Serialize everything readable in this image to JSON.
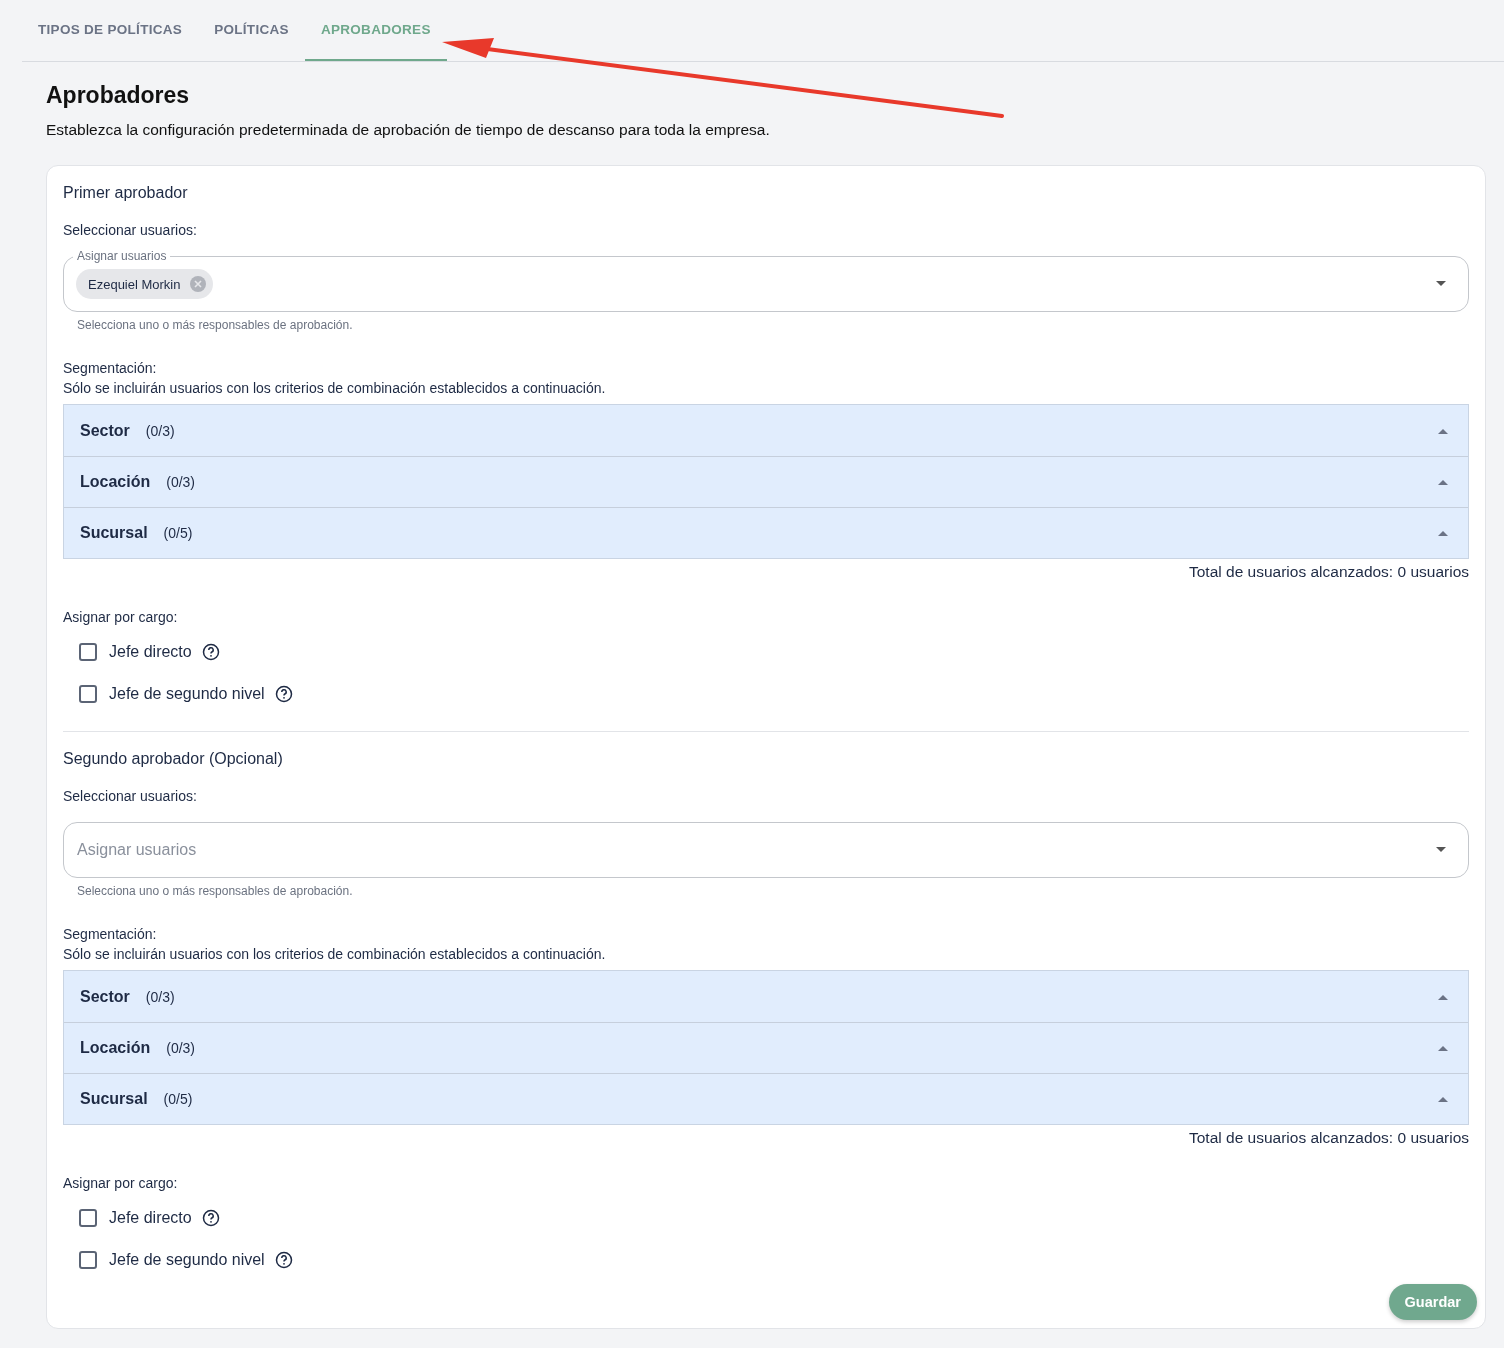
{
  "tabs": [
    {
      "label": "TIPOS DE POLÍTICAS",
      "selected": false
    },
    {
      "label": "POLÍTICAS",
      "selected": false
    },
    {
      "label": "APROBADORES",
      "selected": true
    }
  ],
  "page": {
    "title": "Aprobadores",
    "description": "Establezca la configuración predeterminada de aprobación de tiempo de descanso para toda la empresa."
  },
  "approvers": [
    {
      "title": "Primer aprobador",
      "select_label": "Seleccionar usuarios:",
      "field": {
        "label": "Asignar usuarios",
        "chips": [
          "Ezequiel Morkin"
        ]
      },
      "helper": "Selecciona uno o más responsables de aprobación.",
      "segmentation_label": "Segmentación:",
      "segmentation_note": "Sólo se incluirán usuarios con los criterios de combinación establecidos a continuación.",
      "groups": [
        {
          "name": "Sector",
          "count": "(0/3)"
        },
        {
          "name": "Locación",
          "count": "(0/3)"
        },
        {
          "name": "Sucursal",
          "count": "(0/5)"
        }
      ],
      "total": "Total de usuarios alcanzados: 0 usuarios",
      "role_label": "Asignar por cargo:",
      "roles": [
        {
          "label": "Jefe directo",
          "checked": false
        },
        {
          "label": "Jefe de segundo nivel",
          "checked": false
        }
      ]
    },
    {
      "title": "Segundo aprobador (Opcional)",
      "select_label": "Seleccionar usuarios:",
      "field": {
        "placeholder": "Asignar usuarios"
      },
      "helper": "Selecciona uno o más responsables de aprobación.",
      "segmentation_label": "Segmentación:",
      "segmentation_note": "Sólo se incluirán usuarios con los criterios de combinación establecidos a continuación.",
      "groups": [
        {
          "name": "Sector",
          "count": "(0/3)"
        },
        {
          "name": "Locación",
          "count": "(0/3)"
        },
        {
          "name": "Sucursal",
          "count": "(0/5)"
        }
      ],
      "total": "Total de usuarios alcanzados: 0 usuarios",
      "role_label": "Asignar por cargo:",
      "roles": [
        {
          "label": "Jefe directo",
          "checked": false
        },
        {
          "label": "Jefe de segundo nivel",
          "checked": false
        }
      ]
    }
  ],
  "save_button": "Guardar"
}
